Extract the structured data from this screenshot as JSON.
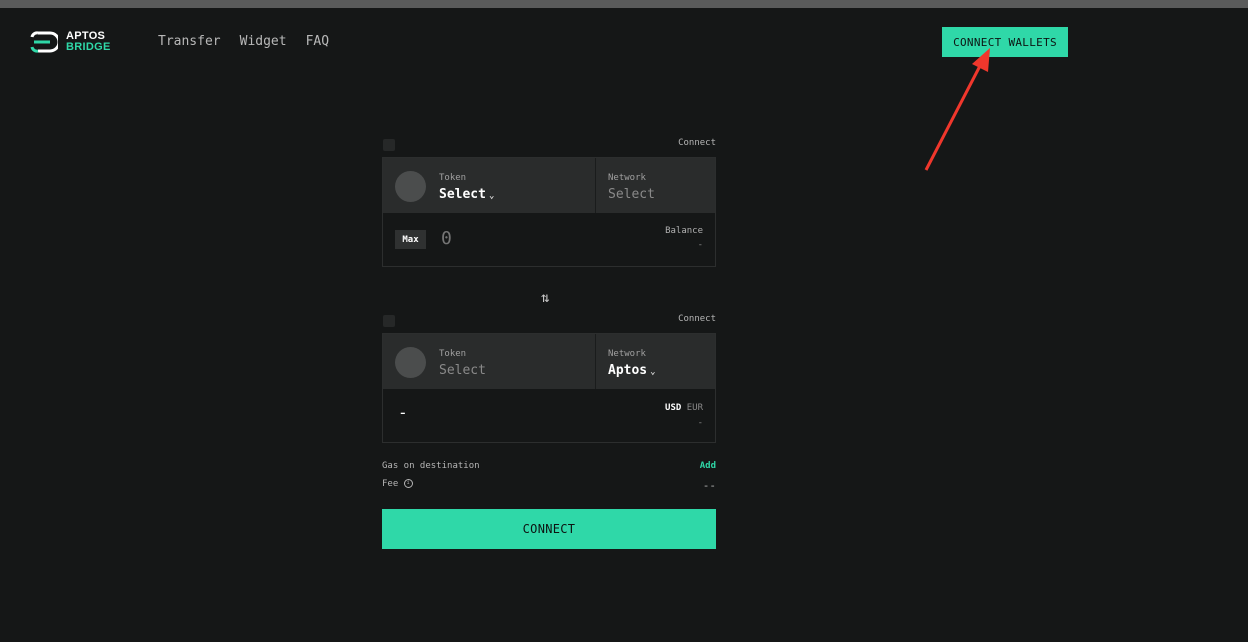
{
  "header": {
    "logo_line1": "APTOS",
    "logo_line2": "BRIDGE",
    "nav": [
      "Transfer",
      "Widget",
      "FAQ"
    ],
    "connect_wallets": "CONNECT WALLETS"
  },
  "source": {
    "connect_label": "Connect",
    "token_label": "Token",
    "token_value": "Select",
    "network_label": "Network",
    "network_value": "Select",
    "max_label": "Max",
    "amount_placeholder": "0",
    "balance_label": "Balance",
    "balance_value": "-"
  },
  "swap_icon": "swap-arrows-icon",
  "destination": {
    "connect_label": "Connect",
    "token_label": "Token",
    "token_value": "Select",
    "network_label": "Network",
    "network_value": "Aptos",
    "amount_value": "-",
    "currency_usd": "USD",
    "currency_eur": "EUR",
    "fiat_value": "-"
  },
  "gas": {
    "label": "Gas on destination",
    "action": "Add"
  },
  "fee": {
    "label": "Fee",
    "value": "--"
  },
  "main_button": "CONNECT",
  "colors": {
    "accent": "#2fd8a8",
    "background": "#151717",
    "panel": "#2a2c2c",
    "annotation_arrow": "#f0372c"
  }
}
